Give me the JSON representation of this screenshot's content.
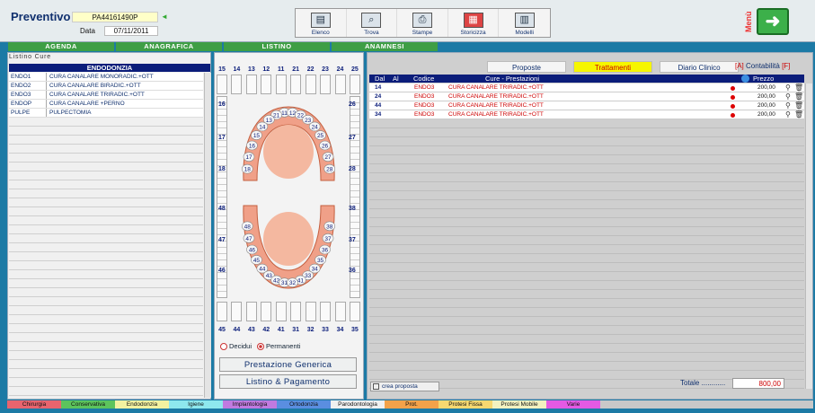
{
  "header": {
    "title": "Preventivo",
    "code": "PA44161490P",
    "date_label": "Data",
    "date": "07/11/2011"
  },
  "toolbar": [
    {
      "label": "Elenco",
      "icon": "list-icon"
    },
    {
      "label": "Trova",
      "icon": "find-icon"
    },
    {
      "label": "Stampe",
      "icon": "printer-icon"
    },
    {
      "label": "Storicizza",
      "icon": "archive-icon"
    },
    {
      "label": "Modelli",
      "icon": "document-icon"
    }
  ],
  "menu": {
    "label": "Menù"
  },
  "navtabs": [
    "AGENDA",
    "ANAGRAFICA",
    "LISTINO",
    "ANAMNESI"
  ],
  "listino": {
    "title": "Listino Cure",
    "section": "ENDODONZIA",
    "items": [
      {
        "code": "ENDO1",
        "desc": "CURA CANALARE MONORADIC.+OTT"
      },
      {
        "code": "ENDO2",
        "desc": "CURA CANALARE BIRADIC.+OTT"
      },
      {
        "code": "ENDO3",
        "desc": "CURA CANALARE TRIRADIC.+OTT"
      },
      {
        "code": "ENDOP",
        "desc": "CURA CANALARE +PERNO"
      },
      {
        "code": "PULPE",
        "desc": "PULPECTOMIA"
      }
    ]
  },
  "odontogram": {
    "top_nums": [
      "15",
      "14",
      "13",
      "12",
      "11",
      "21",
      "22",
      "23",
      "24",
      "25"
    ],
    "bottom_nums": [
      "45",
      "44",
      "43",
      "42",
      "41",
      "31",
      "32",
      "33",
      "34",
      "35"
    ],
    "left_nums": [
      "16",
      "17",
      "18",
      "48",
      "47",
      "46"
    ],
    "right_nums": [
      "26",
      "27",
      "28",
      "38",
      "37",
      "36"
    ],
    "upper_arch": [
      "11",
      "12",
      "21",
      "22",
      "13",
      "23",
      "14",
      "24",
      "15",
      "25",
      "16",
      "26",
      "17",
      "27",
      "18",
      "28"
    ],
    "lower_arch": [
      "48",
      "38",
      "47",
      "37",
      "46",
      "36",
      "45",
      "35",
      "44",
      "34",
      "43",
      "33",
      "42",
      "41",
      "31",
      "32"
    ],
    "decidui": "Decidui",
    "permanenti": "Permanenti",
    "btn_generica": "Prestazione Generica",
    "btn_listino": "Listino & Pagamento"
  },
  "right": {
    "tabs": [
      "Proposte",
      "Trattamenti",
      "Diario Clinico"
    ],
    "contab": {
      "a": "[A]",
      "label": "Contabilità",
      "f": "[F]"
    },
    "columns": {
      "dal": "Dal",
      "al": "Al",
      "codice": "Codice",
      "cure": "Cure - Prestazioni",
      "prezzo": "Prezzo"
    },
    "rows": [
      {
        "dal": "14",
        "al": "",
        "codice": "ENDO3",
        "cure": "CURA CANALARE TRIRADIC.+OTT",
        "prezzo": "200,00"
      },
      {
        "dal": "24",
        "al": "",
        "codice": "ENDO3",
        "cure": "CURA CANALARE TRIRADIC.+OTT",
        "prezzo": "200,00"
      },
      {
        "dal": "44",
        "al": "",
        "codice": "ENDO3",
        "cure": "CURA CANALARE TRIRADIC.+OTT",
        "prezzo": "200,00"
      },
      {
        "dal": "34",
        "al": "",
        "codice": "ENDO3",
        "cure": "CURA CANALARE TRIRADIC.+OTT",
        "prezzo": "200,00"
      }
    ],
    "crea": "crea proposta",
    "totale_label": "Totale ............",
    "totale": "800,00"
  },
  "legend": [
    {
      "label": "Chirurgia",
      "color": "#e8646e"
    },
    {
      "label": "Conservativa",
      "color": "#5cc45c"
    },
    {
      "label": "Endodonzia",
      "color": "#f2f2a0"
    },
    {
      "label": "Igiene",
      "color": "#8ee8ee"
    },
    {
      "label": "Implantologia",
      "color": "#c07ae0"
    },
    {
      "label": "Ortodonzia",
      "color": "#5a8ee0"
    },
    {
      "label": "Parodontologia",
      "color": "#f0f0f0"
    },
    {
      "label": "Prot.",
      "color": "#f2a24a"
    },
    {
      "label": "Protesi Fissa",
      "color": "#f6d870"
    },
    {
      "label": "Protesi Mobile",
      "color": "#f2f2c0"
    },
    {
      "label": "Varie",
      "color": "#e45ae4"
    }
  ]
}
